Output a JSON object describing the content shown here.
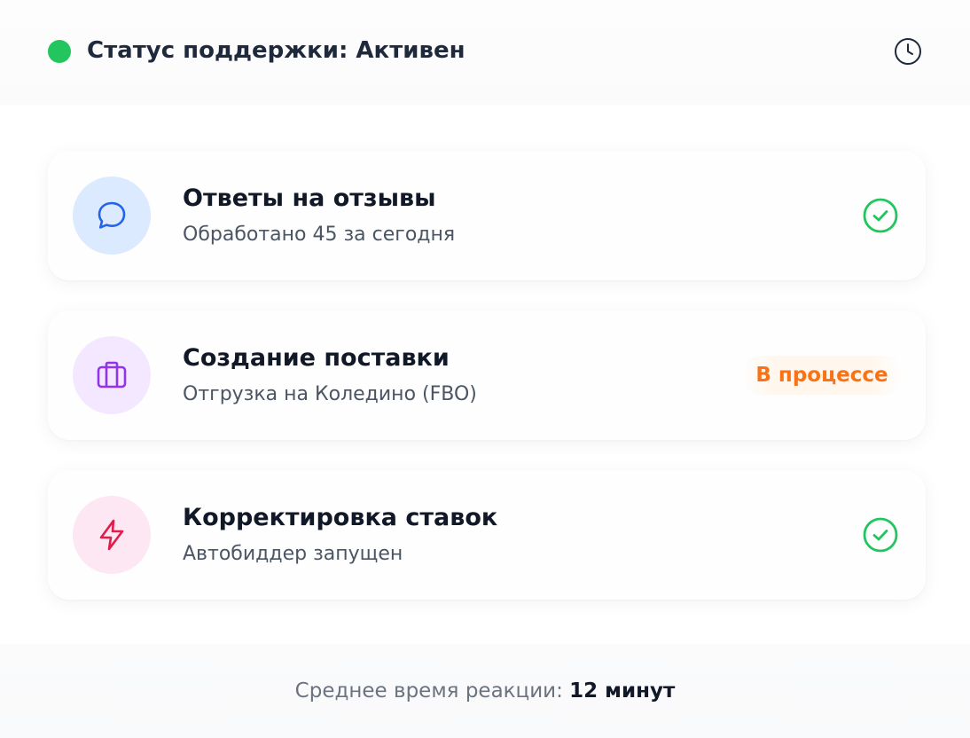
{
  "header": {
    "status_text": "Статус поддержки: Активен",
    "status_color": "#22c55e",
    "clock_icon": "clock-icon"
  },
  "tasks": [
    {
      "title": "Ответы на отзывы",
      "subtitle": "Обработано 45 за сегодня",
      "icon": "chat-bubble-icon",
      "icon_color": "#2563eb",
      "icon_bg": "#dbeafe",
      "status": "done",
      "status_icon": "check-circle-icon"
    },
    {
      "title": "Создание поставки",
      "subtitle": "Отгрузка на Коледино (FBO)",
      "icon": "briefcase-icon",
      "icon_color": "#9333ea",
      "icon_bg": "#f3e8ff",
      "status": "in-progress",
      "status_label": "В процессе",
      "status_color": "#f97316"
    },
    {
      "title": "Корректировка ставок",
      "subtitle": "Автобиддер запущен",
      "icon": "lightning-icon",
      "icon_color": "#e11d48",
      "icon_bg": "#fce7f3",
      "status": "done",
      "status_icon": "check-circle-icon"
    }
  ],
  "footer": {
    "label": "Среднее время реакции:",
    "value": "12 минут"
  },
  "colors": {
    "success": "#22c55e",
    "warning": "#f97316",
    "text_primary": "#111827",
    "text_secondary": "#4b5563"
  }
}
